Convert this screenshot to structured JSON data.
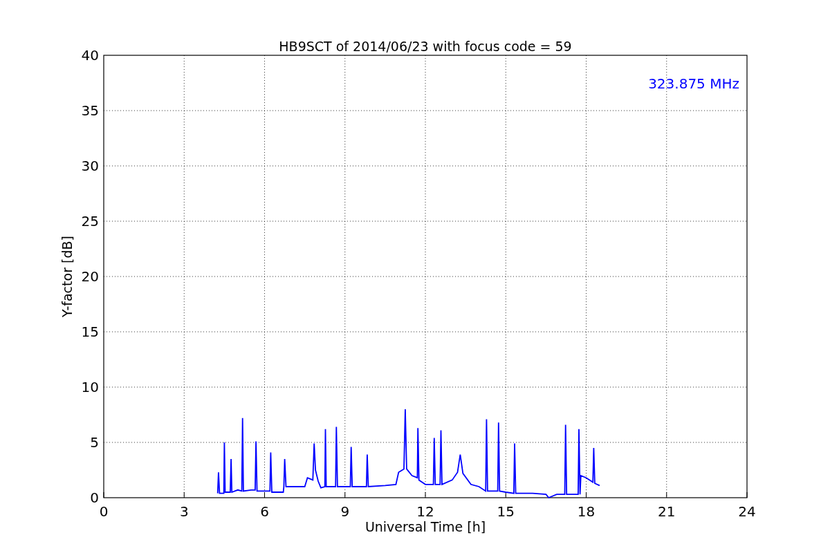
{
  "chart_data": {
    "type": "line",
    "title": "HB9SCT of 2014/06/23 with focus code = 59",
    "xlabel": "Universal Time [h]",
    "ylabel": "Y-factor [dB]",
    "x": [
      4.25,
      4.28,
      4.32,
      4.48,
      4.5,
      4.53,
      4.72,
      4.75,
      4.78,
      5.0,
      5.15,
      5.18,
      5.21,
      5.5,
      5.65,
      5.68,
      5.72,
      6.0,
      6.2,
      6.23,
      6.27,
      6.6,
      6.7,
      6.72,
      6.75,
      6.8,
      7.3,
      7.5,
      7.6,
      7.8,
      7.85,
      7.9,
      8.0,
      8.1,
      8.25,
      8.27,
      8.3,
      8.65,
      8.68,
      8.72,
      9.0,
      9.2,
      9.23,
      9.27,
      9.8,
      9.83,
      9.87,
      10.5,
      10.9,
      11.0,
      11.2,
      11.25,
      11.3,
      11.5,
      11.7,
      11.72,
      11.76,
      12.0,
      12.3,
      12.33,
      12.37,
      12.55,
      12.58,
      12.62,
      13.0,
      13.2,
      13.3,
      13.4,
      13.7,
      14.0,
      14.25,
      14.28,
      14.32,
      14.7,
      14.73,
      14.77,
      15.0,
      15.3,
      15.33,
      15.37,
      16.0,
      16.5,
      16.6,
      16.9,
      17.2,
      17.23,
      17.27,
      17.7,
      17.73,
      17.77,
      17.8,
      18.0,
      18.25,
      18.28,
      18.32,
      18.5
    ],
    "series": [
      {
        "name": "323.875 MHz",
        "color": "#0000ff",
        "values": [
          0.4,
          2.3,
          0.4,
          0.4,
          5.0,
          0.5,
          0.5,
          3.5,
          0.5,
          0.7,
          0.6,
          7.2,
          0.6,
          0.7,
          0.7,
          5.1,
          0.6,
          0.6,
          0.6,
          4.1,
          0.5,
          0.5,
          0.5,
          1.0,
          3.5,
          1.0,
          1.0,
          1.0,
          1.8,
          1.6,
          4.9,
          2.5,
          1.5,
          0.9,
          1.0,
          6.2,
          1.0,
          1.0,
          6.4,
          1.0,
          1.0,
          1.0,
          4.6,
          1.0,
          1.0,
          3.9,
          1.0,
          1.1,
          1.2,
          2.3,
          2.6,
          8.0,
          2.6,
          2.0,
          1.8,
          6.3,
          1.6,
          1.2,
          1.2,
          5.4,
          1.2,
          1.2,
          6.1,
          1.2,
          1.6,
          2.3,
          3.9,
          2.2,
          1.2,
          1.0,
          0.6,
          7.1,
          0.6,
          0.6,
          6.8,
          0.6,
          0.5,
          0.4,
          4.9,
          0.4,
          0.4,
          0.3,
          0.0,
          0.3,
          0.3,
          6.6,
          0.3,
          0.3,
          6.2,
          0.3,
          2.0,
          1.8,
          1.4,
          4.5,
          1.3,
          1.1
        ]
      }
    ],
    "xlim": [
      0,
      24
    ],
    "ylim": [
      0,
      40
    ],
    "xticks": [
      0,
      3,
      6,
      9,
      12,
      15,
      18,
      21,
      24
    ],
    "yticks": [
      0,
      5,
      10,
      15,
      20,
      25,
      30,
      35,
      40
    ],
    "grid": true
  }
}
